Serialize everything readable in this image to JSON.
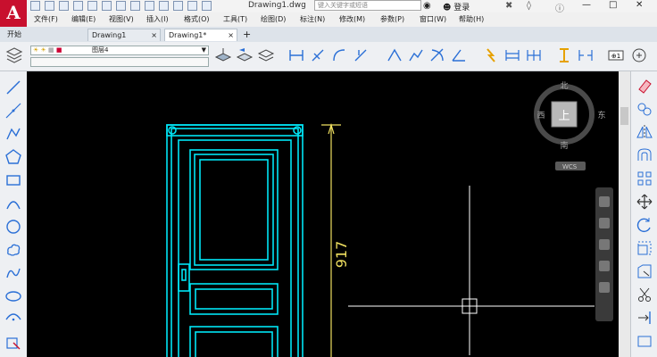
{
  "app": {
    "logo_letter": "A",
    "doc_title": "Drawing1.dwg",
    "search_placeholder": "键入关键字或短语",
    "login": "登录"
  },
  "menu": [
    "文件(F)",
    "编辑(E)",
    "视图(V)",
    "插入(I)",
    "格式(O)",
    "工具(T)",
    "绘图(D)",
    "标注(N)",
    "修改(M)",
    "参数(P)",
    "窗口(W)",
    "帮助(H)"
  ],
  "tabs": {
    "start": "开始",
    "drawing1": "Drawing1",
    "drawing1_active": "Drawing1*",
    "close": "×",
    "add": "+"
  },
  "layer": {
    "name": "图层4"
  },
  "viewcube": {
    "north": "北",
    "south": "南",
    "east": "东",
    "west": "西",
    "top": "上",
    "wcs": "WCS"
  },
  "drawing": {
    "dimension_value": "917"
  },
  "colors": {
    "accent": "#c8102e",
    "door": "#00e5f5",
    "dimension": "#f0e060",
    "crosshair": "#ffffff"
  }
}
